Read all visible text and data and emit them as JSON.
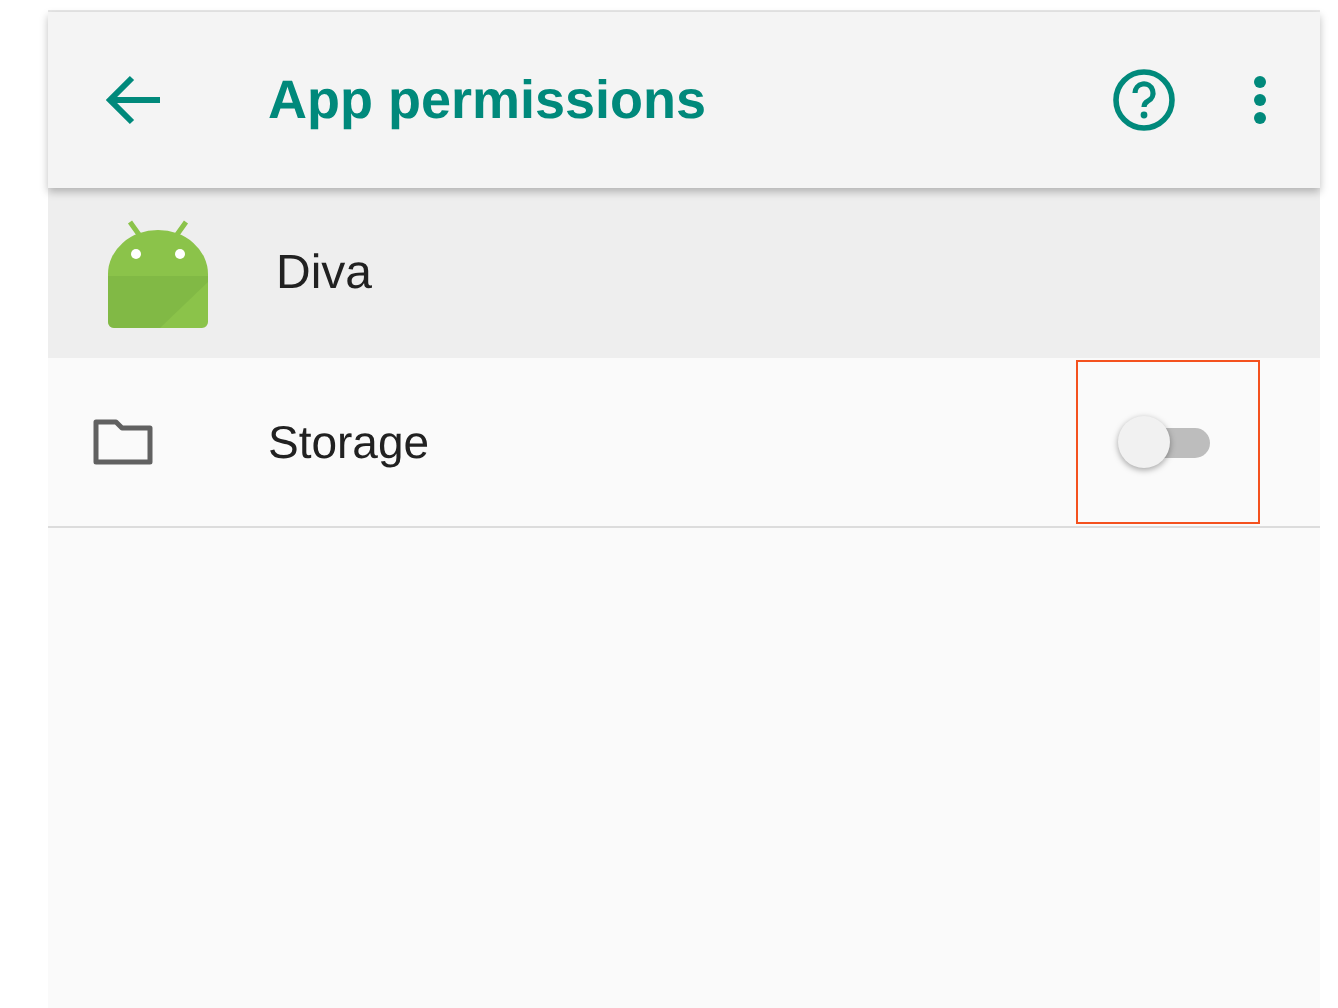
{
  "toolbar": {
    "title": "App permissions"
  },
  "app": {
    "name": "Diva"
  },
  "permissions": [
    {
      "label": "Storage",
      "on": false,
      "highlighted": true
    }
  ]
}
